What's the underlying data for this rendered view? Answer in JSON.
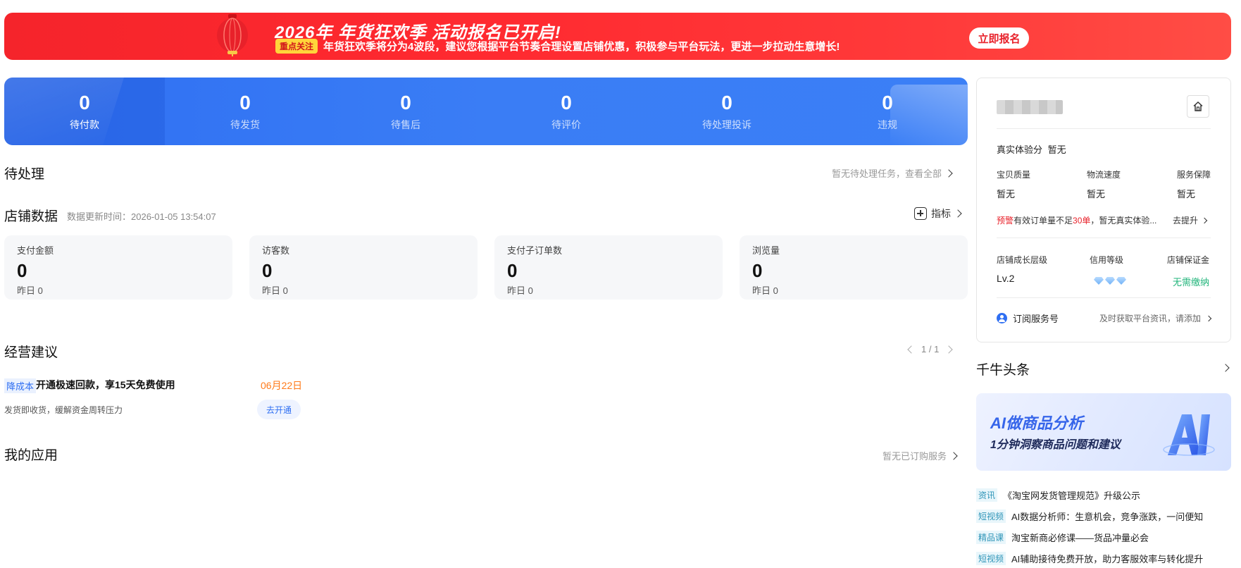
{
  "banner": {
    "title": "2026年 年货狂欢季 活动报名已开启!",
    "tag": "重点关注",
    "desc": "年货狂欢季将分为4波段，建议您根据平台节奏合理设置店铺优惠，积极参与平台玩法，更进一步拉动生意增长!",
    "button": "立即报名",
    "color": "#f5242b"
  },
  "stats": [
    {
      "value": "0",
      "label": "待付款"
    },
    {
      "value": "0",
      "label": "待发货"
    },
    {
      "value": "0",
      "label": "待售后"
    },
    {
      "value": "0",
      "label": "待评价"
    },
    {
      "value": "0",
      "label": "待处理投诉"
    },
    {
      "value": "0",
      "label": "违规"
    }
  ],
  "pending": {
    "title": "待处理",
    "link": "暂无待处理任务，查看全部"
  },
  "store_data": {
    "title": "店铺数据",
    "update_time": "数据更新时间：2026-01-05 13:54:07",
    "metrics_label": "指标",
    "cards": [
      {
        "label": "支付金额",
        "value": "0",
        "yesterday": "昨日 0"
      },
      {
        "label": "访客数",
        "value": "0",
        "yesterday": "昨日 0"
      },
      {
        "label": "支付子订单数",
        "value": "0",
        "yesterday": "昨日 0"
      },
      {
        "label": "浏览量",
        "value": "0",
        "yesterday": "昨日 0"
      }
    ]
  },
  "advice": {
    "title": "经营建议",
    "pager": "1 / 1",
    "item": {
      "tag": "降成本",
      "title": "开通极速回款，享15天免费使用",
      "date": "06月22日",
      "desc": "发货即收货，缓解资金周转压力",
      "button": "去开通"
    }
  },
  "apps": {
    "title": "我的应用",
    "link": "暂无已订购服务"
  },
  "shop": {
    "experience_label": "真实体验分",
    "experience_value": "暂无",
    "scores": [
      {
        "label": "宝贝质量",
        "value": "暂无"
      },
      {
        "label": "物流速度",
        "value": "暂无"
      },
      {
        "label": "服务保障",
        "value": "暂无"
      }
    ],
    "warn_tag": "预警",
    "warn_pre": "有效订单量不足",
    "warn_num": "30单",
    "warn_post": "，暂无真实体验...",
    "promote": "去提升",
    "growth_label": "店铺成长层级",
    "growth_value": "Lv.2",
    "credit_label": "信用等级",
    "deposit_label": "店铺保证金",
    "deposit_value": "无需缴纳",
    "subscribe_label": "订阅服务号",
    "subscribe_desc": "及时获取平台资讯，请添加"
  },
  "news": {
    "title": "千牛头条",
    "ai_title": "AI做商品分析",
    "ai_sub": "1分钟洞察商品问题和建议",
    "items": [
      {
        "tag": "资讯",
        "text": "《淘宝网发货管理规范》升级公示"
      },
      {
        "tag": "短视频",
        "text": "AI数据分析师：生意机会，竞争涨跌，一问便知"
      },
      {
        "tag": "精品课",
        "text": "淘宝新商必修课——货品冲量必会"
      },
      {
        "tag": "短视频",
        "text": "AI辅助接待免费开放，助力客服效率与转化提升"
      }
    ]
  }
}
